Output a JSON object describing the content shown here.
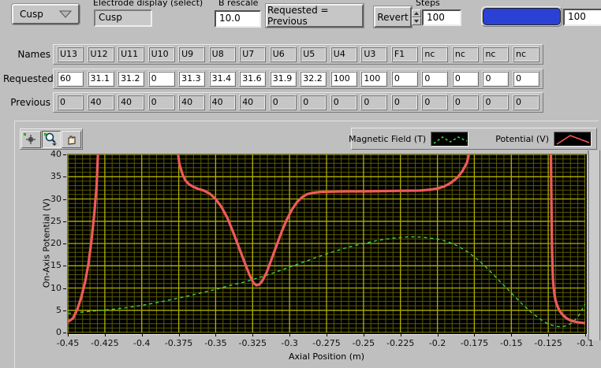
{
  "header": {
    "preset_dropdown": {
      "value": "Cusp"
    },
    "electrode_display": {
      "label": "Electrode display (select)",
      "value": "Cusp"
    },
    "b_rescale": {
      "label": "B rescale",
      "value": "10.0"
    },
    "requested_equals_previous_label": "Requested = Previous",
    "revert_label": "Revert",
    "steps": {
      "label": "Steps",
      "value": "100"
    },
    "step_count_value": "100",
    "progress": {
      "fill_percent": 100,
      "color": "#2b41d6"
    }
  },
  "table": {
    "rows": [
      {
        "label": "Names",
        "editable": true,
        "cell_bg": "#c9c9c9",
        "values": [
          "U13",
          "U12",
          "U11",
          "U10",
          "U9",
          "U8",
          "U7",
          "U6",
          "U5",
          "U4",
          "U3",
          "F1",
          "nc",
          "nc",
          "nc",
          "nc"
        ]
      },
      {
        "label": "Requested",
        "editable": true,
        "cell_bg": "#ffffff",
        "values": [
          "60",
          "31.1",
          "31.2",
          "0",
          "31.3",
          "31.4",
          "31.6",
          "31.9",
          "32.2",
          "100",
          "100",
          "0",
          "0",
          "0",
          "0",
          "0"
        ]
      },
      {
        "label": "Previous",
        "editable": false,
        "cell_bg": "#c6c6c6",
        "values": [
          "0",
          "40",
          "40",
          "0",
          "40",
          "40",
          "40",
          "0",
          "0",
          "0",
          "0",
          "0",
          "0",
          "0",
          "0",
          "0"
        ]
      }
    ]
  },
  "graph": {
    "toolbar": [
      "crosshair-tool",
      "zoom-tool",
      "pan-tool"
    ]
  },
  "chart_data": {
    "type": "line",
    "title": "",
    "xlabel": "Axial Position (m)",
    "ylabel": "On-Axis Potential (V)",
    "xlim": [
      -0.45,
      -0.1
    ],
    "ylim": [
      0,
      40
    ],
    "x_ticks": [
      -0.45,
      -0.425,
      -0.4,
      -0.375,
      -0.35,
      -0.325,
      -0.3,
      -0.275,
      -0.25,
      -0.225,
      -0.2,
      -0.175,
      -0.15,
      -0.125,
      -0.1
    ],
    "x_tick_labels": [
      "-0.45",
      "-0.425",
      "-0.4",
      "-0.375",
      "-0.35",
      "-0.325",
      "-0.3",
      "-0.275",
      "-0.25",
      "-0.225",
      "-0.2",
      "-0.175",
      "-0.15",
      "-0.125",
      "-0.1"
    ],
    "y_ticks": [
      0,
      5,
      10,
      15,
      20,
      25,
      30,
      35,
      40
    ],
    "y_tick_labels": [
      "0",
      "5",
      "10",
      "15",
      "20",
      "25",
      "30",
      "35",
      "40"
    ],
    "x_minor_step": 0.005,
    "y_minor_step": 1,
    "grid": {
      "major_color": "#b0b000",
      "minor_color": "#5a5a00",
      "background": "#000000",
      "on": true
    },
    "legend_position": "top-right",
    "series": [
      {
        "name": "Magnetic Field (T)",
        "color": "#3fd43f",
        "dash": "4,4",
        "width": 1.4,
        "segments": [
          [
            [
              -0.45,
              4.3
            ],
            [
              -0.44,
              4.6
            ],
            [
              -0.43,
              4.9
            ],
            [
              -0.42,
              5.2
            ],
            [
              -0.41,
              5.6
            ],
            [
              -0.4,
              6.1
            ],
            [
              -0.39,
              6.7
            ],
            [
              -0.38,
              7.4
            ],
            [
              -0.37,
              8.1
            ],
            [
              -0.36,
              8.9
            ],
            [
              -0.35,
              9.7
            ],
            [
              -0.34,
              10.6
            ],
            [
              -0.33,
              11.4
            ],
            [
              -0.32,
              12.4
            ],
            [
              -0.31,
              13.5
            ],
            [
              -0.3,
              14.7
            ],
            [
              -0.29,
              15.9
            ],
            [
              -0.28,
              17.1
            ],
            [
              -0.27,
              18.2
            ],
            [
              -0.26,
              19.2
            ],
            [
              -0.25,
              20.0
            ],
            [
              -0.24,
              20.7
            ],
            [
              -0.23,
              21.2
            ],
            [
              -0.222,
              21.45
            ],
            [
              -0.215,
              21.5
            ],
            [
              -0.208,
              21.35
            ],
            [
              -0.2,
              21.0
            ],
            [
              -0.193,
              20.4
            ],
            [
              -0.186,
              19.4
            ],
            [
              -0.179,
              18.0
            ],
            [
              -0.172,
              16.2
            ],
            [
              -0.165,
              14.0
            ],
            [
              -0.158,
              11.6
            ],
            [
              -0.15,
              8.9
            ],
            [
              -0.143,
              6.5
            ],
            [
              -0.136,
              4.4
            ],
            [
              -0.13,
              2.9
            ],
            [
              -0.125,
              1.9
            ],
            [
              -0.12,
              1.4
            ],
            [
              -0.116,
              1.3
            ],
            [
              -0.112,
              1.6
            ],
            [
              -0.108,
              2.4
            ],
            [
              -0.104,
              4.0
            ],
            [
              -0.101,
              5.9
            ],
            [
              -0.1,
              6.5
            ]
          ]
        ]
      },
      {
        "name": "Potential (V)",
        "color": "#f05a5a",
        "dash": "",
        "width": 3.2,
        "segments": [
          [
            [
              -0.45,
              2.4
            ],
            [
              -0.4465,
              3.2
            ],
            [
              -0.4436,
              5.2
            ],
            [
              -0.441,
              7.8
            ],
            [
              -0.4382,
              11.5
            ],
            [
              -0.436,
              15.5
            ],
            [
              -0.4339,
              21
            ],
            [
              -0.432,
              27
            ],
            [
              -0.4305,
              33
            ],
            [
              -0.4295,
              41
            ]
          ],
          [
            [
              -0.3758,
              41
            ],
            [
              -0.3745,
              37.8
            ],
            [
              -0.3725,
              35.6
            ],
            [
              -0.3705,
              34.2
            ],
            [
              -0.368,
              33.3
            ],
            [
              -0.365,
              32.7
            ],
            [
              -0.362,
              32.3
            ],
            [
              -0.358,
              31.9
            ],
            [
              -0.354,
              31.2
            ],
            [
              -0.35,
              30.0
            ],
            [
              -0.346,
              28.2
            ],
            [
              -0.342,
              25.7
            ],
            [
              -0.338,
              22.4
            ],
            [
              -0.334,
              18.9
            ],
            [
              -0.33,
              15.4
            ],
            [
              -0.327,
              12.9
            ],
            [
              -0.3245,
              11.2
            ],
            [
              -0.3225,
              10.6
            ],
            [
              -0.3205,
              10.8
            ],
            [
              -0.3185,
              11.6
            ],
            [
              -0.3155,
              13.5
            ],
            [
              -0.3125,
              16.2
            ],
            [
              -0.309,
              19.4
            ],
            [
              -0.3055,
              22.5
            ],
            [
              -0.302,
              25.3
            ],
            [
              -0.2985,
              27.6
            ],
            [
              -0.295,
              29.3
            ],
            [
              -0.2915,
              30.4
            ],
            [
              -0.288,
              31.1
            ],
            [
              -0.284,
              31.4
            ],
            [
              -0.279,
              31.6
            ],
            [
              -0.27,
              31.65
            ],
            [
              -0.26,
              31.7
            ],
            [
              -0.25,
              31.7
            ],
            [
              -0.24,
              31.75
            ],
            [
              -0.23,
              31.8
            ],
            [
              -0.22,
              31.85
            ],
            [
              -0.212,
              31.9
            ],
            [
              -0.206,
              32.05
            ],
            [
              -0.2,
              32.35
            ],
            [
              -0.1955,
              32.8
            ],
            [
              -0.191,
              33.6
            ],
            [
              -0.1865,
              34.8
            ],
            [
              -0.183,
              36.3
            ],
            [
              -0.18,
              38.2
            ],
            [
              -0.178,
              41
            ]
          ],
          [
            [
              -0.1232,
              41
            ],
            [
              -0.123,
              33
            ],
            [
              -0.1228,
              27
            ],
            [
              -0.1226,
              22
            ],
            [
              -0.1224,
              18
            ],
            [
              -0.1221,
              14.5
            ],
            [
              -0.1218,
              12
            ],
            [
              -0.1214,
              10.2
            ],
            [
              -0.1208,
              8.5
            ],
            [
              -0.12,
              7.1
            ],
            [
              -0.1188,
              5.9
            ],
            [
              -0.1172,
              4.8
            ],
            [
              -0.115,
              3.9
            ],
            [
              -0.1122,
              3.1
            ],
            [
              -0.109,
              2.6
            ],
            [
              -0.105,
              2.3
            ],
            [
              -0.1,
              2.1
            ]
          ]
        ]
      }
    ]
  }
}
